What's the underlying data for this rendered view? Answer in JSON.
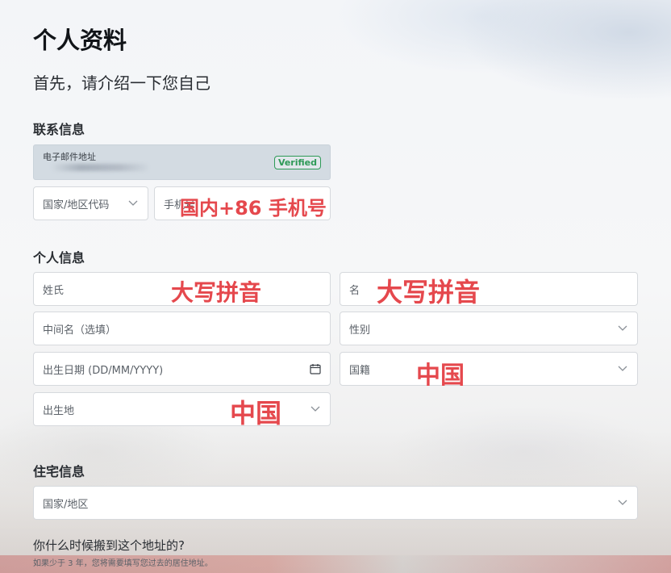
{
  "page": {
    "title": "个人资料",
    "subtitle": "首先，请介绍一下您自己"
  },
  "contact": {
    "section_title": "联系信息",
    "email_label": "电子邮件地址",
    "verified_badge": "Verified",
    "country_code_placeholder": "国家/地区代码",
    "phone_placeholder": "手机号"
  },
  "personal": {
    "section_title": "个人信息",
    "surname_placeholder": "姓氏",
    "given_name_placeholder": "名",
    "middle_name_placeholder": "中间名（选填）",
    "gender_placeholder": "性别",
    "dob_placeholder": "出生日期 (DD/MM/YYYY)",
    "nationality_placeholder": "国籍",
    "birthplace_placeholder": "出生地"
  },
  "residence": {
    "section_title": "住宅信息",
    "country_placeholder": "国家/地区",
    "question": "你什么时候搬到这个地址的?",
    "hint": "如果少于 3 年，您将需要填写您过去的居住地址。"
  },
  "annotations": {
    "phone_note": "国内+86 手机号",
    "surname_note": "大写拼音",
    "given_name_note": "大写拼音",
    "nationality_note": "中国",
    "birthplace_note": "中国",
    "color": "#e5484d"
  },
  "colors": {
    "verified_green": "#2e9a57",
    "field_border": "#d6d9dd",
    "email_bg": "#d3dbe2"
  }
}
